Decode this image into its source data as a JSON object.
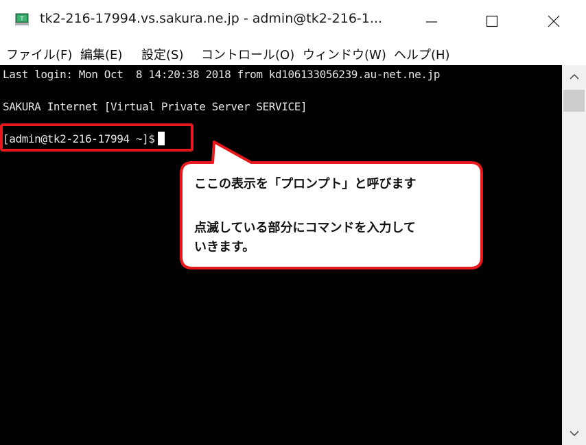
{
  "window": {
    "title": "tk2-216-17994.vs.sakura.ne.jp - admin@tk2-216-1...",
    "app_icon": "terminal-app-icon",
    "controls": [
      "minimize-icon",
      "maximize-icon",
      "close-icon"
    ]
  },
  "menu": {
    "items": [
      {
        "label": "ファイル(F)"
      },
      {
        "label": "編集(E)"
      },
      {
        "label": "設定(S)"
      },
      {
        "label": "コントロール(O)"
      },
      {
        "label": "ウィンドウ(W)"
      },
      {
        "label": "ヘルプ(H)"
      }
    ]
  },
  "terminal": {
    "lines": [
      "Last login: Mon Oct  8 14:20:38 2018 from kd106133056239.au-net.ne.jp",
      "SAKURA Internet [Virtual Private Server SERVICE]",
      "[admin@tk2-216-17994 ~]$"
    ]
  },
  "annotation": {
    "line1": "ここの表示を「プロンプト」と呼びます",
    "line2": "点滅している部分にコマンドを入力して",
    "line3": "いきます。",
    "highlight_color": "#e8191c"
  }
}
